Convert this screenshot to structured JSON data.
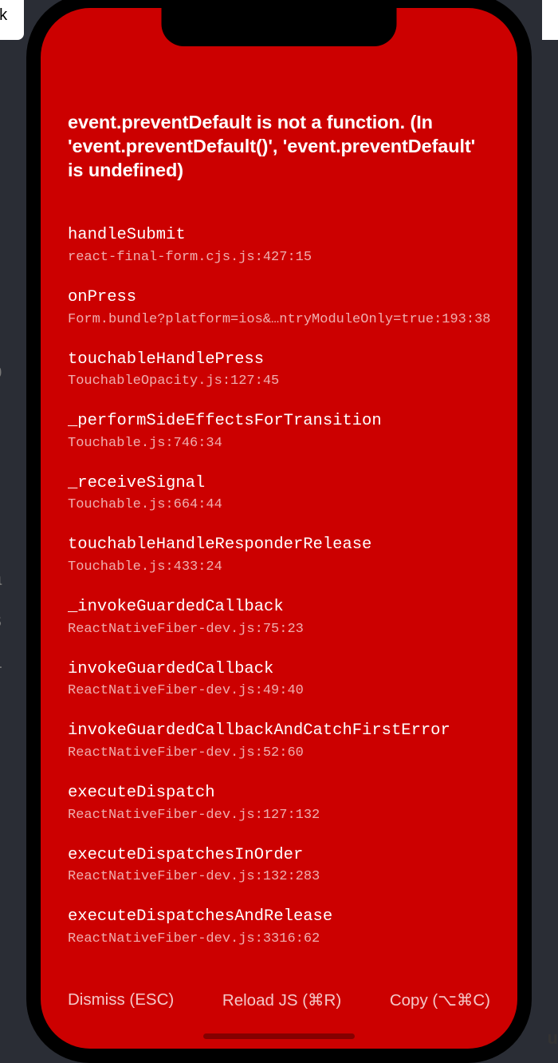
{
  "bg": {
    "tab_text": "ek",
    "right_text": "ul"
  },
  "error": {
    "title": "event.preventDefault is not a function. (In 'event.preventDefault()', 'event.preventDefault' is undefined)"
  },
  "stack": [
    {
      "fn": "handleSubmit",
      "loc": "react-final-form.cjs.js:427:15"
    },
    {
      "fn": "onPress",
      "loc": "Form.bundle?platform=ios&…ntryModuleOnly=true:193:38"
    },
    {
      "fn": "touchableHandlePress",
      "loc": "TouchableOpacity.js:127:45"
    },
    {
      "fn": "_performSideEffectsForTransition",
      "loc": "Touchable.js:746:34"
    },
    {
      "fn": "_receiveSignal",
      "loc": "Touchable.js:664:44"
    },
    {
      "fn": "touchableHandleResponderRelease",
      "loc": "Touchable.js:433:24"
    },
    {
      "fn": "_invokeGuardedCallback",
      "loc": "ReactNativeFiber-dev.js:75:23"
    },
    {
      "fn": "invokeGuardedCallback",
      "loc": "ReactNativeFiber-dev.js:49:40"
    },
    {
      "fn": "invokeGuardedCallbackAndCatchFirstError",
      "loc": "ReactNativeFiber-dev.js:52:60"
    },
    {
      "fn": "executeDispatch",
      "loc": "ReactNativeFiber-dev.js:127:132"
    },
    {
      "fn": "executeDispatchesInOrder",
      "loc": "ReactNativeFiber-dev.js:132:283"
    },
    {
      "fn": "executeDispatchesAndRelease",
      "loc": "ReactNativeFiber-dev.js:3316:62"
    }
  ],
  "buttons": {
    "dismiss": "Dismiss (ESC)",
    "reload": "Reload JS (⌘R)",
    "copy": "Copy (⌥⌘C)"
  }
}
